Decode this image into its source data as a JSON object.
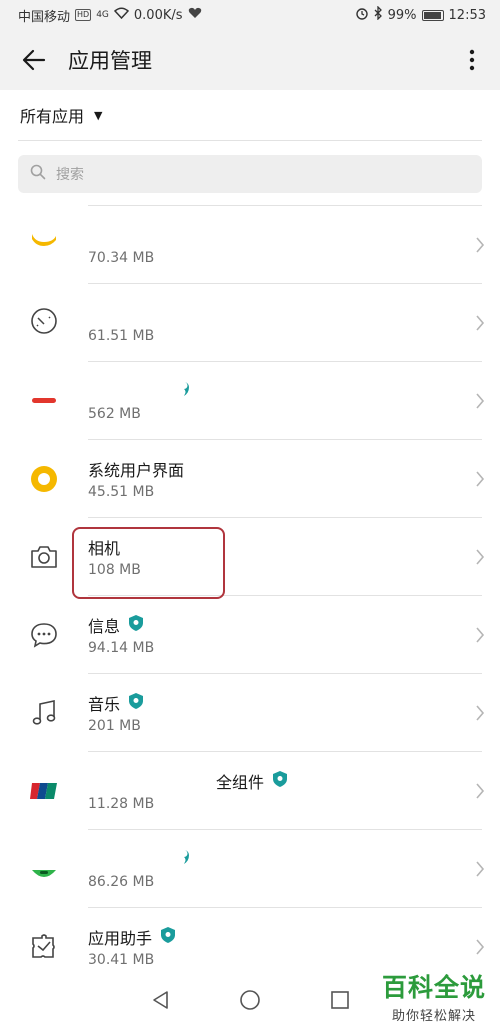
{
  "status_bar": {
    "carrier": "中国移动",
    "hd": "HD",
    "signal": "4G",
    "speed": "0.00K/s",
    "battery": "99%",
    "time": "12:53"
  },
  "header": {
    "title": "应用管理"
  },
  "filter": {
    "label": "所有应用"
  },
  "search": {
    "placeholder": "搜索"
  },
  "apps": [
    {
      "name": "",
      "size": "70.34 MB"
    },
    {
      "name": "",
      "size": "61.51 MB"
    },
    {
      "name": "",
      "size": "562 MB"
    },
    {
      "name": "系统用户界面",
      "size": "45.51 MB"
    },
    {
      "name": "相机",
      "size": "108 MB"
    },
    {
      "name": "信息",
      "size": "94.14 MB"
    },
    {
      "name": "音乐",
      "size": "201 MB"
    },
    {
      "name": "全组件",
      "size": "11.28 MB"
    },
    {
      "name": "",
      "size": "86.26 MB"
    },
    {
      "name": "应用助手",
      "size": "30.41 MB"
    }
  ],
  "watermark": {
    "title": "百科全说",
    "subtitle": "助你轻松解决"
  },
  "colors": {
    "highlight": "#b0353d",
    "badge": "#1a9c9c",
    "watermark": "#2c9b3c"
  }
}
